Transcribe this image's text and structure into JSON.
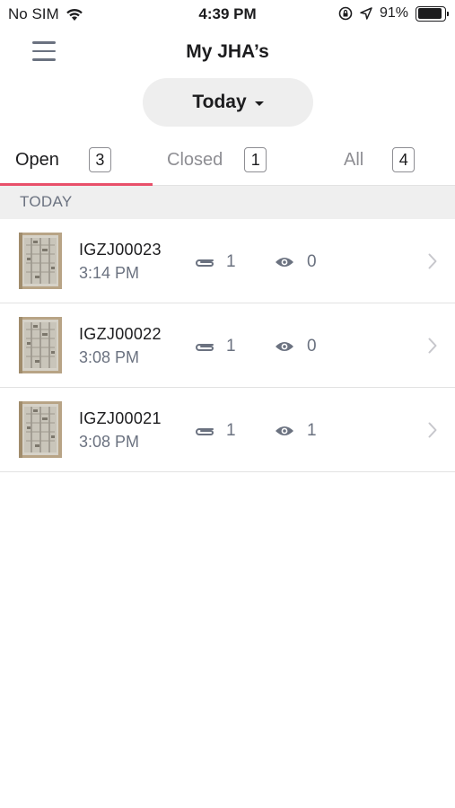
{
  "status_bar": {
    "carrier": "No SIM",
    "time": "4:39 PM",
    "battery": "91%",
    "battery_level": 0.91,
    "icons": [
      "wifi-icon",
      "orientation-lock-icon",
      "location-arrow-icon",
      "battery-icon"
    ]
  },
  "nav": {
    "title": "My JHA’s",
    "menu_icon": "hamburger-menu-icon"
  },
  "date_filter": {
    "label": "Today",
    "icon": "caret-down-icon"
  },
  "tabs": [
    {
      "label": "Open",
      "count": "3",
      "active": true
    },
    {
      "label": "Closed",
      "count": "1",
      "active": false
    },
    {
      "label": "All",
      "count": "4",
      "active": false
    }
  ],
  "accent_color": "#e8506a",
  "section": {
    "header": "TODAY"
  },
  "items": [
    {
      "id": "IGZJ00023",
      "time": "3:14 PM",
      "attachments": "1",
      "views": "0"
    },
    {
      "id": "IGZJ00022",
      "time": "3:08 PM",
      "attachments": "1",
      "views": "0"
    },
    {
      "id": "IGZJ00021",
      "time": "3:08 PM",
      "attachments": "1",
      "views": "1"
    }
  ]
}
